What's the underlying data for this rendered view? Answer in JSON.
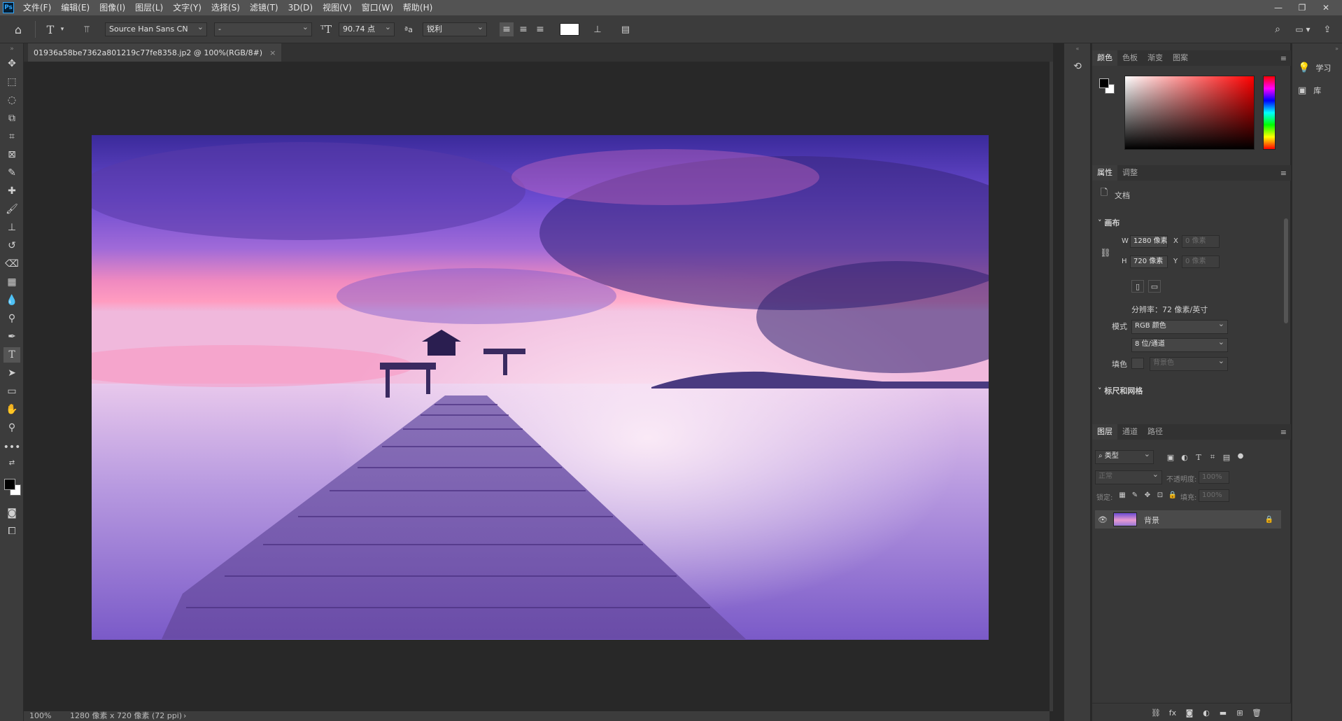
{
  "menubar": {
    "app_icon": "Ps",
    "items": [
      "文件(F)",
      "编辑(E)",
      "图像(I)",
      "图层(L)",
      "文字(Y)",
      "选择(S)",
      "滤镜(T)",
      "3D(D)",
      "视图(V)",
      "窗口(W)",
      "帮助(H)"
    ]
  },
  "options": {
    "font_family": "Source Han Sans CN",
    "font_style": "-",
    "font_size": "90.74 点",
    "aa_label": "ªa",
    "antialias": "锐利"
  },
  "document": {
    "tab_title": "01936a58be7362a801219c77fe8358.jp2 @ 100%(RGB/8#)",
    "close": "×"
  },
  "status": {
    "zoom": "100%",
    "info": "1280 像素 x 720 像素 (72 ppi)",
    "arrow": "›"
  },
  "color_panel": {
    "tabs": [
      "颜色",
      "色板",
      "渐变",
      "图案"
    ],
    "foreground": "#000000",
    "background": "#ffffff",
    "hue_color": "#ff0000"
  },
  "properties_panel": {
    "tabs": [
      "属性",
      "调整"
    ],
    "doc_label": "文档",
    "canvas_section": "画布",
    "w_label": "W",
    "w_value": "1280 像素",
    "h_label": "H",
    "h_value": "720 像素",
    "x_label": "X",
    "x_placeholder": "0 像素",
    "y_label": "Y",
    "y_placeholder": "0 像素",
    "resolution": "分辨率：72 像素/英寸",
    "mode_label": "模式",
    "mode_value": "RGB 颜色",
    "depth_value": "8 位/通道",
    "fill_label": "填色",
    "fill_value": "背景色",
    "rulers_section": "标尺和网格"
  },
  "layers_panel": {
    "tabs": [
      "图层",
      "通道",
      "路径"
    ],
    "filter_placeholder": "类型",
    "blend_mode": "正常",
    "opacity_label": "不透明度:",
    "opacity_value": "100%",
    "lock_label": "锁定:",
    "fill_label": "填充:",
    "fill_value": "100%",
    "layers": [
      {
        "name": "背景",
        "visible": true,
        "locked": true
      }
    ]
  },
  "right_dock": {
    "learn": "学习",
    "library": "库"
  }
}
